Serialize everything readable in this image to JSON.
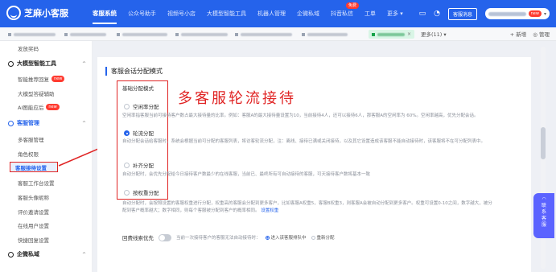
{
  "app": {
    "logo_text": "芝麻小客服"
  },
  "nav": [
    {
      "label": "客服系统",
      "active": true
    },
    {
      "label": "公众号助手"
    },
    {
      "label": "视频号小店"
    },
    {
      "label": "大模型智能工具"
    },
    {
      "label": "机器人管理"
    },
    {
      "label": "企微私域"
    },
    {
      "label": "抖音私信",
      "badge": "免费"
    },
    {
      "label": "工单"
    },
    {
      "label": "更多",
      "caret": "▾"
    }
  ],
  "header": {
    "message_button": "客服消息",
    "user_badge": "new",
    "user_caret": "▾",
    "icons": {
      "monitor": "monitor-icon",
      "bell": "bell-icon"
    }
  },
  "tabbar": {
    "more": "更多(11) ▾",
    "new": "+ 新增",
    "manage": "◎ 管理"
  },
  "sidebar": {
    "top_item": "发放奖码",
    "groups": [
      {
        "label": "大模型智能工具",
        "caret": "^"
      },
      {
        "label": "客服管理",
        "caret": "^"
      },
      {
        "label": "企微私域",
        "caret": "^"
      }
    ],
    "items_ai": [
      {
        "label": "智能推荐回复",
        "badge": "new"
      },
      {
        "label": "大模型答疑辅助"
      },
      {
        "label": "AI图能应后",
        "badge": "new"
      }
    ],
    "items_service": [
      {
        "label": "多客服管理"
      },
      {
        "label": "角色权限"
      },
      {
        "label": "客服接待设置",
        "active": true
      },
      {
        "label": "客服工作台设置"
      },
      {
        "label": "客服头像昵称"
      },
      {
        "label": "评价邀请设置"
      },
      {
        "label": "在线用户设置"
      },
      {
        "label": "快捷回复设置"
      }
    ]
  },
  "main": {
    "section_title": "客服会话分配模式",
    "mode_label": "基础分配模式",
    "annotation": "多客服轮流接待",
    "options": [
      {
        "label": "空闲率分配",
        "selected": false
      },
      {
        "label": "轮流分配",
        "selected": true
      },
      {
        "label": "补齐分配",
        "selected": false
      },
      {
        "label": "按权重分配",
        "selected": false
      }
    ],
    "desc_idle": "空闲率指客服当前可接待客户数占最大接待量的比率。例如：客服A的最大接待量设置为10，当前接待4人，还可以接待6人，那客服A的空闲率为 60%。空闲率越高，优先分配会话。",
    "desc_round": "自动分配会话给客服时，系统会根据当前可分配的客服列表，将访客轮流分配，注：离线、接待已满或关闭接待，以及其它设置造成该客服不能自动接待时，该客服将不在可分配列表中。",
    "desc_fill": "自动分配时，会优先分配给今日接待客户数最少的在线客服，当前已、最终所有可自动接待的客服，可天接待客户数将基本一致",
    "desc_weight": "自动分配时，会按照设置的客服权重进行分配，权重高的客服会分配到更多客户，比如客服A权重5，客服B权重3，则客服A会被自动分配到更多客户。权重可设置0-10之间，数字越大，被分配到客户概率越大；数字相同，则每个客服被分配到客户的概率相同。",
    "desc_weight_link": "设置权重",
    "toggle_label": "回费线索优先",
    "toggle_desc": "当前一次接待客户的客服无法自动接待时：",
    "toggle_opt1": "进入该客服排队中",
    "toggle_opt2": "重新分配"
  },
  "float": {
    "lines": [
      "联",
      "系",
      "客",
      "服"
    ]
  },
  "colors": {
    "brand": "#2563eb",
    "annotation": "#e02424"
  }
}
